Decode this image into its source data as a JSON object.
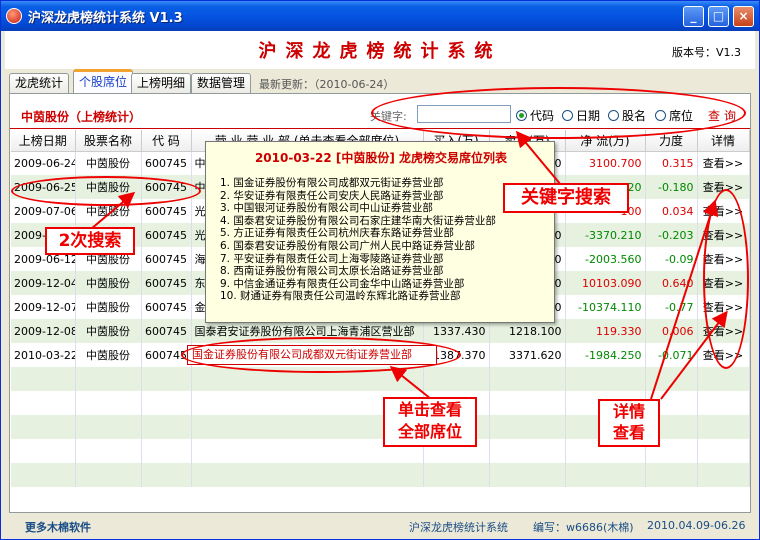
{
  "window": {
    "title": "沪深龙虎榜统计系统 V1.3",
    "minimize": "_",
    "maximize": "□",
    "close": "×"
  },
  "header": {
    "title": "沪深龙虎榜统计系统",
    "version": "版本号：V1.3"
  },
  "tabs": [
    {
      "label": "龙虎统计",
      "active": false
    },
    {
      "label": "个股席位",
      "active": true
    },
    {
      "label": "上榜明细",
      "active": false
    },
    {
      "label": "数据管理",
      "active": false
    }
  ],
  "last_update": "最新更新：（2010-06-24）",
  "panel": {
    "section_title": "中茵股份（上榜统计）",
    "keyword_label": "关键字:",
    "keyword_value": "",
    "radios": [
      {
        "label": "代码",
        "checked": true
      },
      {
        "label": "日期",
        "checked": false
      },
      {
        "label": "股名",
        "checked": false
      },
      {
        "label": "席位",
        "checked": false
      }
    ],
    "query_label": "查询"
  },
  "table": {
    "columns": [
      "上榜日期",
      "股票名称",
      "代 码",
      "营 业 营 业 部 (单击查看全部席位)",
      "买入(万)",
      "卖出(万)",
      "净 流(万)",
      "力度",
      "详情"
    ],
    "rows": [
      {
        "date": "2009-06-24",
        "name": "中茵股份",
        "code": "600745",
        "dept": "中信证券股份有限公司",
        "buy": "",
        "sell": "5.620",
        "net": "3100.700",
        "net_color": "red",
        "power": "0.315",
        "power_color": "red",
        "detail": "查看>>"
      },
      {
        "date": "2009-06-25",
        "name": "中茵股份",
        "code": "600745",
        "dept": "中信证券股份有限公司",
        "buy": "",
        "sell": "320",
        "net": "320",
        "net_color": "green",
        "power": "-0.180",
        "power_color": "green",
        "detail": "查看>>"
      },
      {
        "date": "2009-07-06",
        "name": "中茵股份",
        "code": "600745",
        "dept": "光大证券",
        "buy": "",
        "sell": "",
        "net": "100",
        "net_color": "red",
        "power": "0.034",
        "power_color": "red",
        "detail": "查看>>"
      },
      {
        "date": "2009-07",
        "name": "中茵股份",
        "code": "600745",
        "dept": "光大证券",
        "buy": "",
        "sell": "2.060",
        "net": "-3370.210",
        "net_color": "green",
        "power": "-0.203",
        "power_color": "green",
        "detail": "查看>>"
      },
      {
        "date": "2009-06-12",
        "name": "中茵股份",
        "code": "600745",
        "dept": "海通证券",
        "buy": "",
        "sell": "2.580",
        "net": "-2003.560",
        "net_color": "green",
        "power": "-0.09",
        "power_color": "green",
        "detail": "查看>>"
      },
      {
        "date": "2009-12-04",
        "name": "中茵股份",
        "code": "600745",
        "dept": "东吴证券",
        "buy": "",
        "sell": "3.450",
        "net": "10103.090",
        "net_color": "red",
        "power": "0.640",
        "power_color": "red",
        "detail": "查看>>"
      },
      {
        "date": "2009-12-07",
        "name": "中茵股份",
        "code": "600745",
        "dept": "金元证券",
        "buy": "",
        "sell": "5.580",
        "net": "-10374.110",
        "net_color": "green",
        "power": "-0.77",
        "power_color": "green",
        "detail": "查看>>"
      },
      {
        "date": "2009-12-08",
        "name": "中茵股份",
        "code": "600745",
        "dept": "国泰君安证券股份有限公司上海青浦区营业部",
        "buy": "1337.430",
        "sell": "1218.100",
        "net": "119.330",
        "net_color": "red",
        "power": "0.006",
        "power_color": "red",
        "detail": "查看>>"
      },
      {
        "date": "2010-03-22",
        "name": "中茵股份",
        "code": "600745",
        "dept": "",
        "buy": "1387.370",
        "sell": "3371.620",
        "net": "-1984.250",
        "net_color": "green",
        "power": "-0.071",
        "power_color": "green",
        "detail": "查看>>"
      }
    ]
  },
  "popup": {
    "title": "2010-03-22 [中茵股份] 龙虎榜交易席位列表",
    "items": [
      "1. 国金证券股份有限公司成都双元街证券营业部",
      "2. 华安证券有限责任公司安庆人民路证券营业部",
      "3. 中国银河证券股份有限公司中山证券营业部",
      "4. 国泰君安证券股份有限公司石家庄建华南大街证券营业部",
      "5. 方正证券有限责任公司杭州庆春东路证券营业部",
      "6. 国泰君安证券股份有限公司广州人民中路证券营业部",
      "7. 平安证券有限责任公司上海零陵路证券营业部",
      "8. 西南证券股份有限公司太原长治路证券营业部",
      "9. 中信金通证券有限责任公司金华中山路证券营业部",
      "10. 财通证券有限责任公司温岭东辉北路证券营业部"
    ]
  },
  "cell_link": "国金证券股份有限公司成都双元街证券营业部",
  "annotations": {
    "keyword_search": "关键字搜索",
    "second_search": "2次搜索",
    "click_view_l1": "单击查看",
    "click_view_l2": "全部席位",
    "detail_view_l1": "详情",
    "detail_view_l2": "查看"
  },
  "footer": {
    "more": "更多木棉软件",
    "app": "沪深龙虎榜统计系统",
    "author": "编写：w6686(木棉)",
    "date": "2010.04.09-06.26"
  },
  "colors": {
    "accent_red": "#cc0000",
    "titlebar_blue": "#0554e2",
    "row_alt": "#e6f1df",
    "footer_text": "#1a4d86"
  }
}
